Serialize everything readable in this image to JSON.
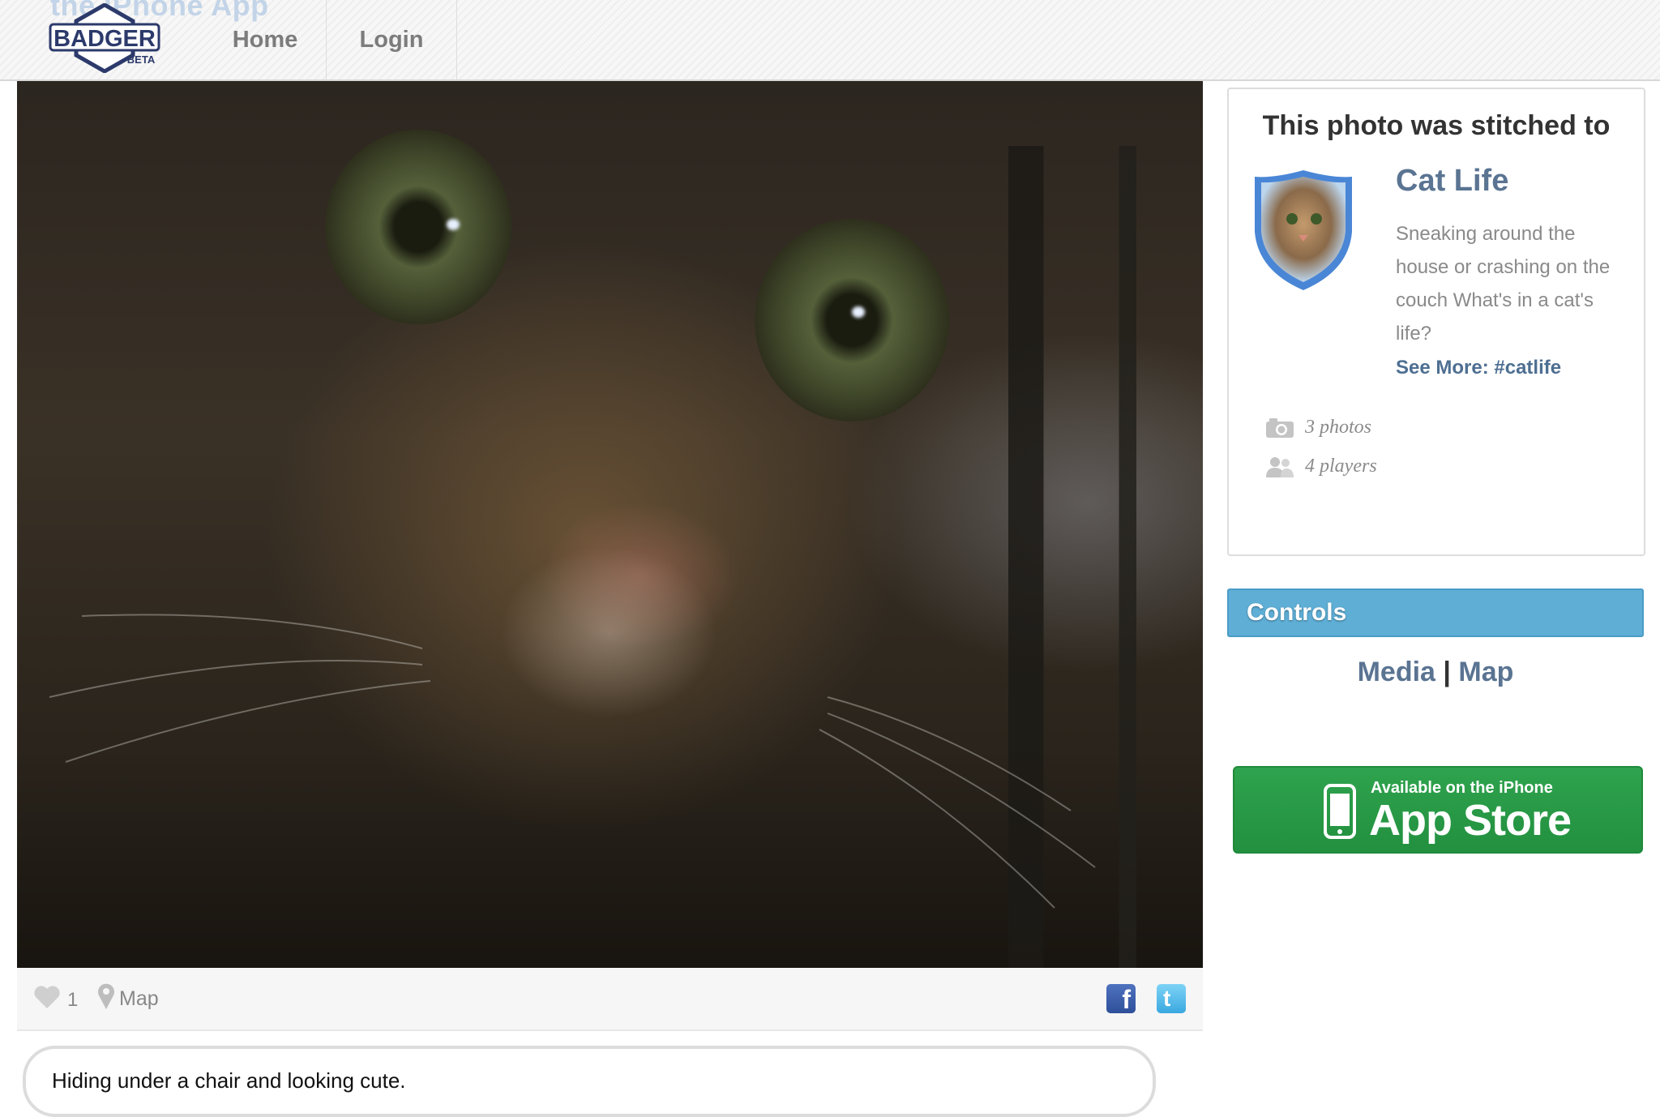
{
  "header": {
    "tagline": "the iPhone App",
    "logo_text": "BADGER",
    "logo_badge": "BETA",
    "nav": [
      {
        "label": "Home"
      },
      {
        "label": "Login"
      }
    ]
  },
  "photo": {
    "like_count": "1",
    "map_label": "Map",
    "caption": "Hiding under a chair and looking cute."
  },
  "sidebar": {
    "stitched_title": "This photo was stitched to",
    "group_name": "Cat Life",
    "group_description": "Sneaking around the house or crashing on the couch What's in a cat's life?",
    "see_more": "See More: #catlife",
    "stats": {
      "photos": "3 photos",
      "players": "4 players"
    },
    "controls_title": "Controls",
    "controls_links": {
      "media": "Media",
      "separator": "|",
      "map": "Map"
    },
    "appstore": {
      "small": "Available on the iPhone",
      "big": "App Store"
    }
  },
  "colors": {
    "link": "#5a7492",
    "controls_header": "#5eaed6",
    "appstore_green": "#2fa34e"
  },
  "icons": [
    "heart-icon",
    "map-pin-icon",
    "facebook-icon",
    "twitter-icon",
    "camera-icon",
    "players-icon",
    "iphone-icon"
  ]
}
